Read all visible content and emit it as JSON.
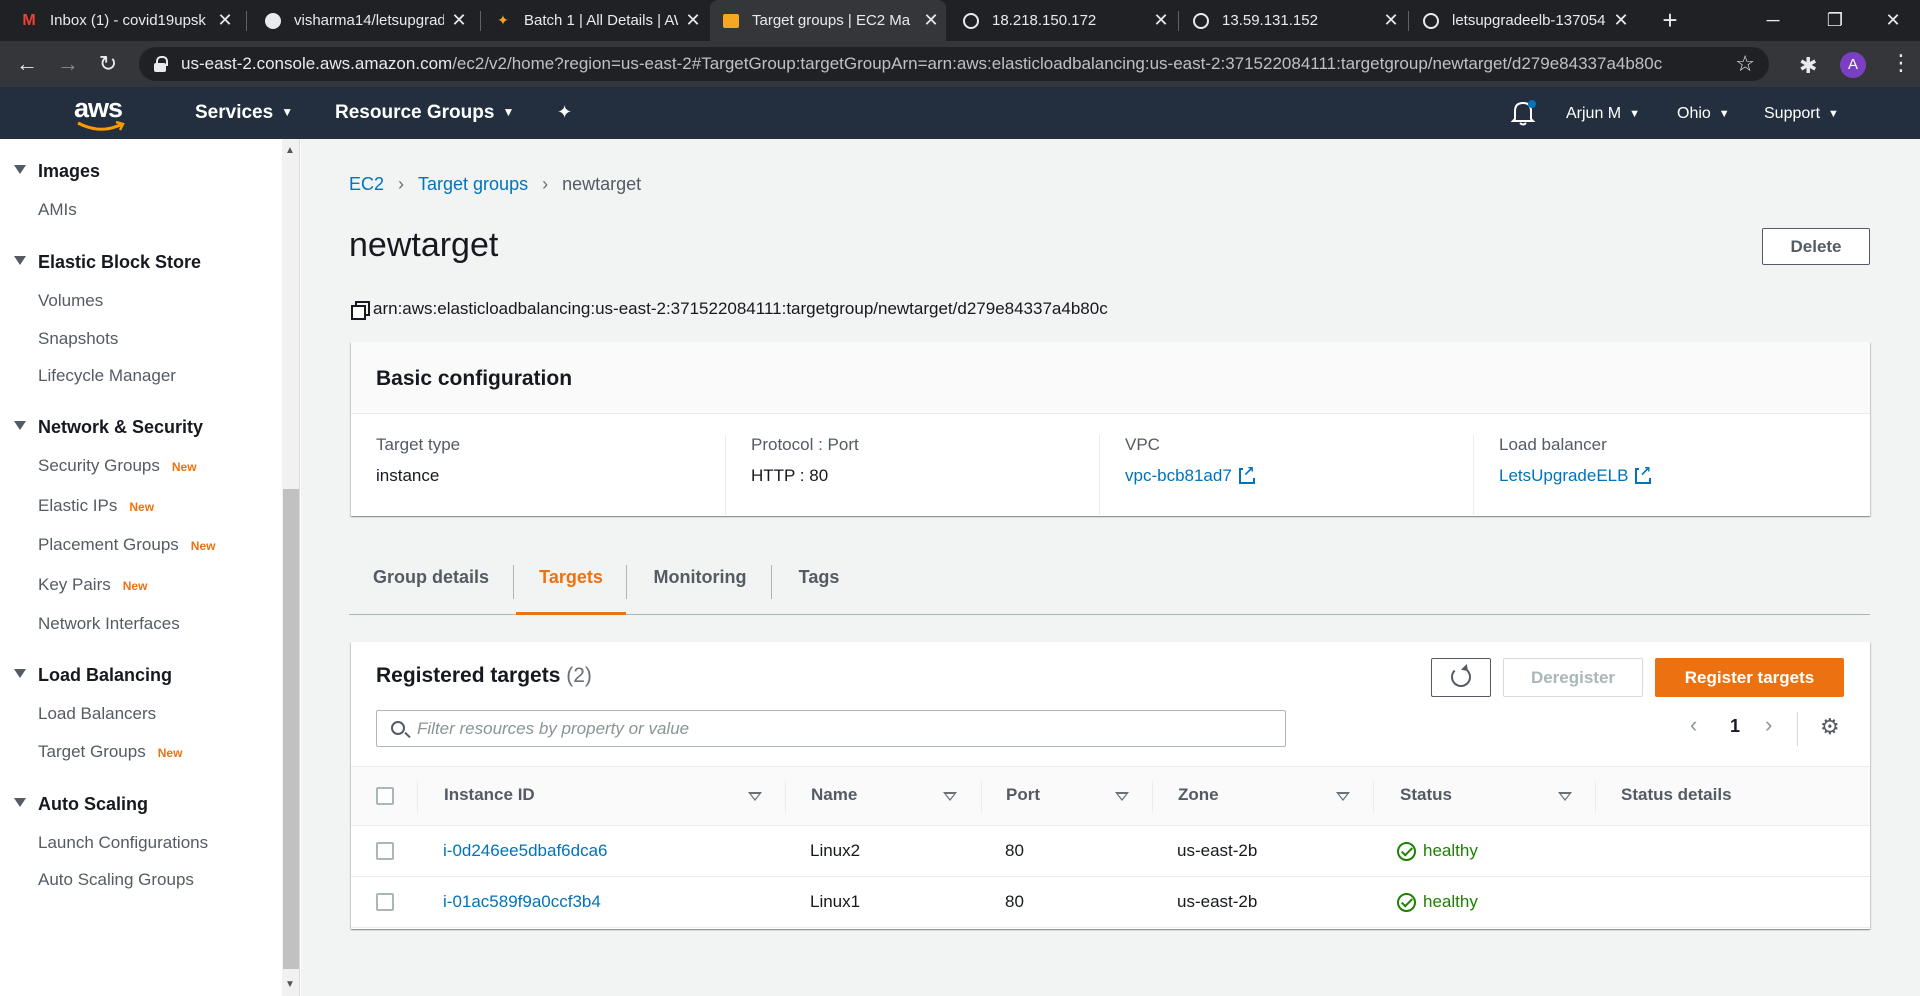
{
  "browser": {
    "tabs": [
      {
        "title": "Inbox (1) - covid19upsk",
        "icon": "gmail-icon"
      },
      {
        "title": "visharma14/letsupgrad",
        "icon": "github-icon"
      },
      {
        "title": "Batch 1 | All Details | AW",
        "icon": "letsupgrade-icon"
      },
      {
        "title": "Target groups | EC2 Ma",
        "icon": "aws-box-icon"
      },
      {
        "title": "18.218.150.172",
        "icon": "globe-icon"
      },
      {
        "title": "13.59.131.152",
        "icon": "globe-icon"
      },
      {
        "title": "letsupgradeelb-137054",
        "icon": "globe-icon"
      }
    ],
    "url_host": "us-east-2.console.aws.amazon.com",
    "url_rest": "/ec2/v2/home?region=us-east-2#TargetGroup:targetGroupArn=arn:aws:elasticloadbalancing:us-east-2:371522084111:targetgroup/newtarget/d279e84337a4b80c",
    "profile_initial": "A"
  },
  "aws_header": {
    "logo": "aws",
    "services": "Services",
    "resource_groups": "Resource Groups",
    "user": "Arjun M",
    "region": "Ohio",
    "support": "Support"
  },
  "sidebar": {
    "new_badge": "New",
    "images": {
      "label": "Images",
      "items": [
        "AMIs"
      ]
    },
    "ebs": {
      "label": "Elastic Block Store",
      "items": [
        "Volumes",
        "Snapshots",
        "Lifecycle Manager"
      ]
    },
    "network": {
      "label": "Network & Security",
      "items": [
        "Security Groups",
        "Elastic IPs",
        "Placement Groups",
        "Key Pairs",
        "Network Interfaces"
      ]
    },
    "lb": {
      "label": "Load Balancing",
      "items": [
        "Load Balancers",
        "Target Groups"
      ]
    },
    "autoscaling": {
      "label": "Auto Scaling",
      "items": [
        "Launch Configurations",
        "Auto Scaling Groups"
      ]
    }
  },
  "breadcrumb": {
    "ec2": "EC2",
    "target_groups": "Target groups",
    "current": "newtarget"
  },
  "page": {
    "title": "newtarget",
    "delete_label": "Delete",
    "arn": "arn:aws:elasticloadbalancing:us-east-2:371522084111:targetgroup/newtarget/d279e84337a4b80c"
  },
  "basic_config": {
    "title": "Basic configuration",
    "target_type_label": "Target type",
    "target_type": "instance",
    "protocol_label": "Protocol : Port",
    "protocol": "HTTP : 80",
    "vpc_label": "VPC",
    "vpc": "vpc-bcb81ad7",
    "lb_label": "Load balancer",
    "lb": "LetsUpgradeELB"
  },
  "tabs": [
    "Group details",
    "Targets",
    "Monitoring",
    "Tags"
  ],
  "targets": {
    "title": "Registered targets",
    "count": "(2)",
    "deregister": "Deregister",
    "register": "Register targets",
    "filter_placeholder": "Filter resources by property or value",
    "page": "1",
    "columns": [
      "Instance ID",
      "Name",
      "Port",
      "Zone",
      "Status",
      "Status details"
    ],
    "rows": [
      {
        "id": "i-0d246ee5dbaf6dca6",
        "name": "Linux2",
        "port": "80",
        "zone": "us-east-2b",
        "status": "healthy",
        "details": ""
      },
      {
        "id": "i-01ac589f9a0ccf3b4",
        "name": "Linux1",
        "port": "80",
        "zone": "us-east-2b",
        "status": "healthy",
        "details": ""
      }
    ]
  },
  "colors": {
    "accent": "#ec7211",
    "link": "#0073bb",
    "healthy": "#1d8102",
    "header": "#232f3e"
  }
}
